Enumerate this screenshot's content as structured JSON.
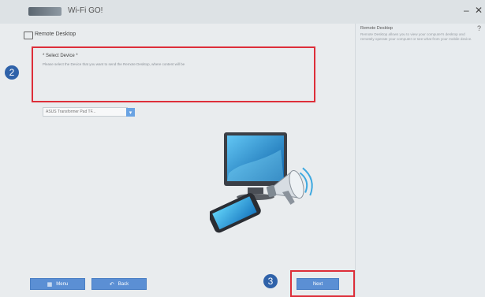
{
  "app": {
    "title": "Wi-Fi GO!",
    "minimize": "–",
    "close": "✕"
  },
  "main": {
    "section_title": "Remote Desktop",
    "select": {
      "title": "* Select Device *",
      "description": "Please select the Device that you want to send the Remote Desktop, where content will be",
      "dropdown_value": "ASUS Transformer Pad TF..."
    }
  },
  "right_panel": {
    "title": "Remote Desktop",
    "description": "Remote Desktop allows you to view your computer's desktop and remotely operate your computer or see what from your mobile device.",
    "help": "?"
  },
  "footer": {
    "menu_label": "Menu",
    "back_label": "Back",
    "next_label": "Next"
  },
  "annotations": {
    "step2": "2",
    "step3": "3"
  },
  "colors": {
    "highlight": "#dd2e39",
    "badge": "#2f62a9",
    "button": "#5b8fd4"
  }
}
